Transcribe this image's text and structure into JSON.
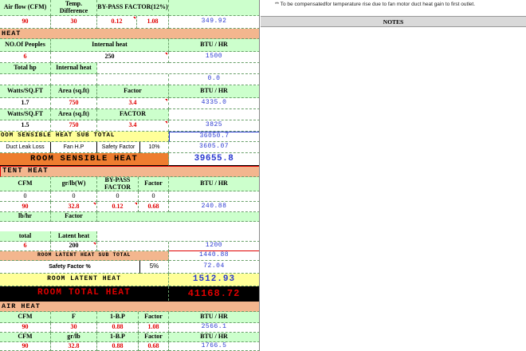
{
  "notes_top": "** To be compensatedfor temperature rise due to fan motor duct heat gain to first outlet.",
  "notes_header": "NOTES",
  "r0": {
    "c1": "Air flow (CFM)",
    "c2": "Temp. Difference",
    "c3": "BY-PASS FACTOR(12%)"
  },
  "r1": {
    "c1": "90",
    "c2": "30",
    "c3": "0.12",
    "c4": "1.08",
    "c5": "349.92"
  },
  "sec_heat": "HEAT",
  "r3": {
    "c1": "NO.Of Peoples",
    "c2": "Internal heat",
    "c3": "BTU / HR"
  },
  "r4": {
    "c1": "6",
    "c2": "250",
    "c3": "1500"
  },
  "r5": {
    "c1": "Total hp",
    "c2": "Internal heat"
  },
  "r6": {
    "c1": "0.0"
  },
  "r7": {
    "c1": "Watts/SQ.FT",
    "c2": "Area (sq.ft)",
    "c3": "Factor",
    "c4": "BTU / HR"
  },
  "r8": {
    "c1": "1.7",
    "c2": "750",
    "c3": "3.4",
    "c4": "4335.0"
  },
  "r9": {
    "c1": "Watts/SQ.FT",
    "c2": "Area (sq.ft)",
    "c3": "FACTOR"
  },
  "r10": {
    "c1": "1.5",
    "c2": "750",
    "c3": "3.4",
    "c4": "3825"
  },
  "r11": {
    "c1": "OOM SENSIBLE HEAT SUB TOTAL",
    "c2": "36050.7"
  },
  "r12": {
    "c1": "Duct Leak Loss",
    "c2": "Fan H.P",
    "c3": "Safety Factor",
    "c4": "10%",
    "c5": "3605.07"
  },
  "r13": {
    "c1": "ROOM SENSIBLE HEAT",
    "c2": "39655.8"
  },
  "sec_latent": "TENT HEAT",
  "r15": {
    "c1": "CFM",
    "c2": "gr/lb(W)",
    "c3": "BY-PASS FACTOR",
    "c4": "Factor",
    "c5": "BTU / HR"
  },
  "r16": {
    "c1": "0",
    "c2": "0",
    "c3": "0",
    "c4": "0"
  },
  "r17": {
    "c1": "90",
    "c2": "32.8",
    "c3": "0.12",
    "c4": "0.68",
    "c5": "240.88"
  },
  "r18": {
    "c1": "lb/hr",
    "c2": "Factor"
  },
  "r20": {
    "c1": "total",
    "c2": "Latent heat"
  },
  "r21": {
    "c1": "6",
    "c2": "200",
    "c3": "1200"
  },
  "r22": {
    "c1": "ROOM LATENT HEAT SUB TOTAL",
    "c2": "1440.88"
  },
  "r23": {
    "c1": "Safety Factor %",
    "c2": "5%",
    "c3": "72.04"
  },
  "r24": {
    "c1": "ROOM LATENT HEAT",
    "c2": "1512.93"
  },
  "r25": {
    "c1": "ROOM TOTAL HEAT",
    "c2": "41168.72"
  },
  "sec_air": "AIR HEAT",
  "r27": {
    "c1": "CFM",
    "c2": "F",
    "c3": "1-B.P",
    "c4": "Factor",
    "c5": "BTU / HR"
  },
  "r28": {
    "c1": "90",
    "c2": "30",
    "c3": "0.88",
    "c4": "1.08",
    "c5": "2566.1"
  },
  "r29": {
    "c1": "CFM",
    "c2": "gr/lb",
    "c3": "1-B.P",
    "c4": "Factor",
    "c5": "BTU / HR"
  },
  "r30": {
    "c1": "90",
    "c2": "32.8",
    "c3": "0.88",
    "c4": "0.68",
    "c5": "1766.5"
  },
  "colors": {
    "header_green": "#ccffcc",
    "section_orange": "#f3b68e",
    "sensible_orange": "#ee7d2f",
    "latent_yellow": "#ffff99",
    "total_black": "#000000",
    "value_blue": "#2a39d0",
    "value_red": "#e00000"
  }
}
